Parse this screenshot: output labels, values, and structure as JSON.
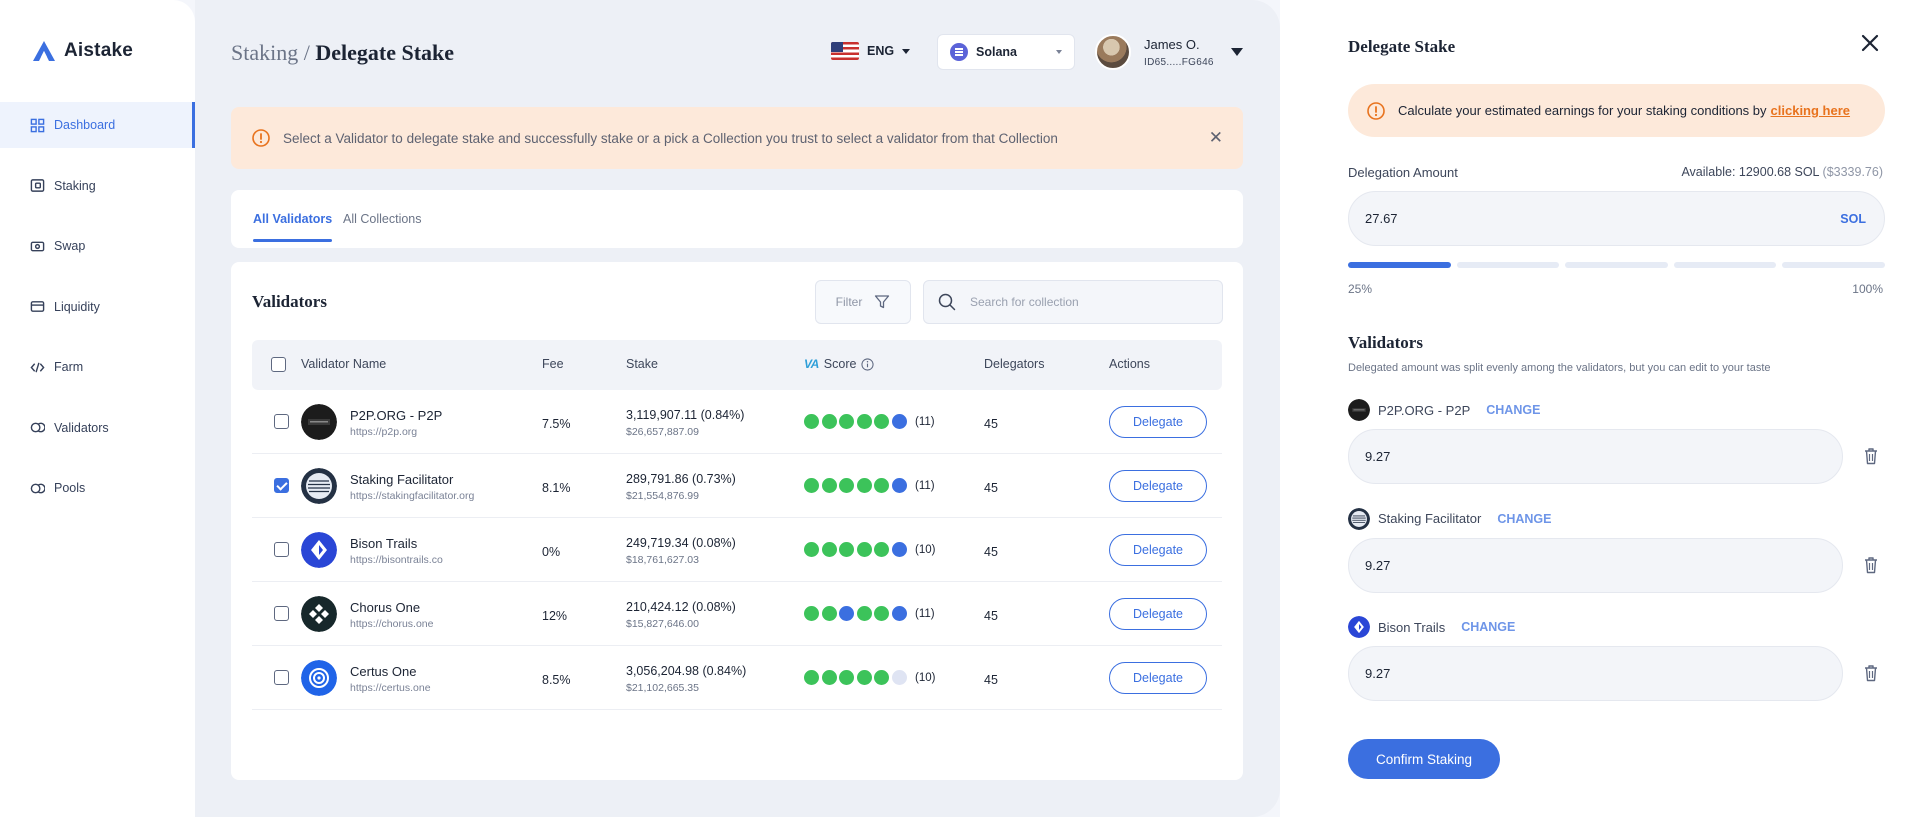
{
  "app": {
    "name": "Aistake"
  },
  "sidebar": {
    "items": [
      {
        "label": "Dashboard",
        "icon": "grid-icon",
        "active": true
      },
      {
        "label": "Staking",
        "icon": "wallet-icon"
      },
      {
        "label": "Swap",
        "icon": "exchange-icon"
      },
      {
        "label": "Liquidity",
        "icon": "card-icon"
      },
      {
        "label": "Farm",
        "icon": "code-icon"
      },
      {
        "label": "Validators",
        "icon": "loop-icon"
      },
      {
        "label": "Pools",
        "icon": "loop-icon"
      }
    ]
  },
  "header": {
    "breadcrumb_parent": "Staking",
    "breadcrumb_sep": " / ",
    "breadcrumb_current": "Delegate Stake",
    "language": "ENG",
    "network": "Solana",
    "user_name": "James O.",
    "user_id": "ID65.....FG646"
  },
  "alert": {
    "text": "Select a Validator to delegate stake and successfully stake or a pick a Collection you trust to select a validator from that Collection"
  },
  "tabs": [
    {
      "label": "All Validators",
      "active": true
    },
    {
      "label": "All Collections",
      "active": false
    }
  ],
  "validators_table": {
    "title": "Validators",
    "filter_label": "Filter",
    "search_placeholder": "Search for collection",
    "columns": {
      "name": "Validator Name",
      "fee": "Fee",
      "stake": "Stake",
      "score": "Score",
      "score_badge": "VA",
      "delegators": "Delegators",
      "actions": "Actions"
    },
    "rows": [
      {
        "name": "P2P.ORG - P2P",
        "url": "https://p2p.org",
        "fee": "7.5%",
        "stake": "3,119,907.11 (0.84%)",
        "stake_usd": "$26,657,887.09",
        "dots": [
          "g",
          "g",
          "g",
          "g",
          "g",
          "b"
        ],
        "score_count": "(11)",
        "delegators": "45",
        "action": "Delegate",
        "checked": false,
        "logo": "p2p"
      },
      {
        "name": "Staking Facilitator",
        "url": "https://stakingfacilitator.org",
        "fee": "8.1%",
        "stake": "289,791.86 (0.73%)",
        "stake_usd": "$21,554,876.99",
        "dots": [
          "g",
          "g",
          "g",
          "g",
          "g",
          "b"
        ],
        "score_count": "(11)",
        "delegators": "45",
        "action": "Delegate",
        "checked": true,
        "logo": "sf"
      },
      {
        "name": "Bison Trails",
        "url": "https://bisontrails.co",
        "fee": "0%",
        "stake": "249,719.34 (0.08%)",
        "stake_usd": "$18,761,627.03",
        "dots": [
          "g",
          "g",
          "g",
          "g",
          "g",
          "b"
        ],
        "score_count": "(10)",
        "delegators": "45",
        "action": "Delegate",
        "checked": false,
        "logo": "bison"
      },
      {
        "name": "Chorus One",
        "url": "https://chorus.one",
        "fee": "12%",
        "stake": "210,424.12 (0.08%)",
        "stake_usd": "$15,827,646.00",
        "dots": [
          "g",
          "g",
          "b",
          "g",
          "g",
          "b"
        ],
        "score_count": "(11)",
        "delegators": "45",
        "action": "Delegate",
        "checked": false,
        "logo": "chorus"
      },
      {
        "name": "Certus One",
        "url": "https://certus.one",
        "fee": "8.5%",
        "stake": "3,056,204.98 (0.84%)",
        "stake_usd": "$21,102,665.35",
        "dots": [
          "g",
          "g",
          "g",
          "g",
          "g",
          "l"
        ],
        "score_count": "(10)",
        "delegators": "45",
        "action": "Delegate",
        "checked": false,
        "logo": "certus"
      }
    ]
  },
  "panel": {
    "title": "Delegate Stake",
    "alert_text": "Calculate your estimated earnings for your staking conditions by",
    "alert_link": "clicking here",
    "amount_label": "Delegation Amount",
    "available_label": "Available: 12900.68 SOL",
    "available_usd": "($3339.76)",
    "amount_value": "27.67",
    "amount_unit": "SOL",
    "progress_fraction": 0.25,
    "progress_min": "25%",
    "progress_max": "100%",
    "validators_title": "Validators",
    "validators_desc": "Delegated amount was split evenly among the validators, but you can edit to your taste",
    "selected": [
      {
        "name": "P2P.ORG - P2P",
        "change": "CHANGE",
        "amount": "9.27",
        "logo": "p2p"
      },
      {
        "name": "Staking Facilitator",
        "change": "CHANGE",
        "amount": "9.27",
        "logo": "sf"
      },
      {
        "name": "Bison Trails",
        "change": "CHANGE",
        "amount": "9.27",
        "logo": "bison"
      }
    ],
    "confirm_label": "Confirm Staking"
  },
  "colors": {
    "accent": "#3b6fe0",
    "alert_bg": "#fde9da",
    "link_orange": "#e8731e",
    "score_green": "#3cc35a",
    "score_blue": "#3b6fe0"
  }
}
